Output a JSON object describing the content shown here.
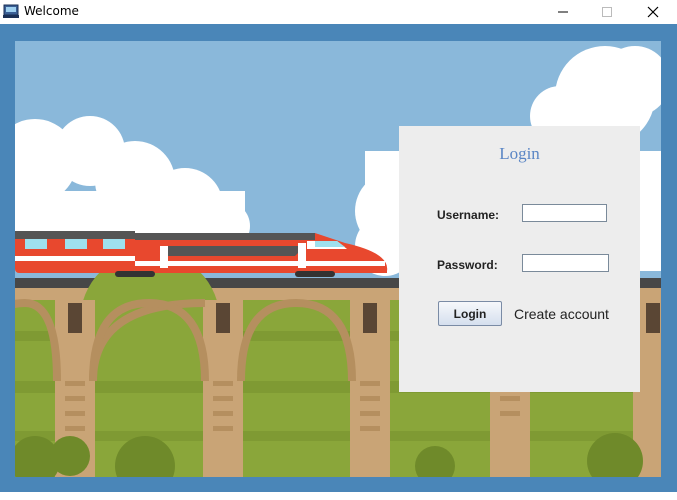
{
  "window": {
    "title": "Welcome",
    "icons": [
      "app-icon",
      "minimize-icon",
      "maximize-icon",
      "close-icon"
    ]
  },
  "login": {
    "heading": "Login",
    "username_label": "Username:",
    "username_value": "",
    "password_label": "Password:",
    "password_value": "",
    "login_button": "Login",
    "create_account": "Create account"
  },
  "colors": {
    "frame": "#4a86b8",
    "sky": "#8ab8da",
    "grass": "#8aa63a",
    "panel": "#ededed",
    "heading": "#5b86c5",
    "train_red": "#e8482e"
  }
}
